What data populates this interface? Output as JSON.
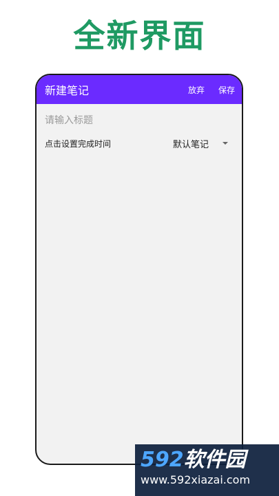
{
  "promo": {
    "title": "全新界面",
    "title_color": "#1f9a63"
  },
  "appbar": {
    "title": "新建笔记",
    "discard_label": "放弃",
    "save_label": "保存",
    "color": "#6b2bff"
  },
  "editor": {
    "title_placeholder": "请输入标题",
    "title_value": "",
    "time_label": "点击设置完成时间",
    "category_selected": "默认笔记"
  },
  "watermark": {
    "number": "592",
    "name": "软件园",
    "url": "www.592xiazai.com"
  }
}
